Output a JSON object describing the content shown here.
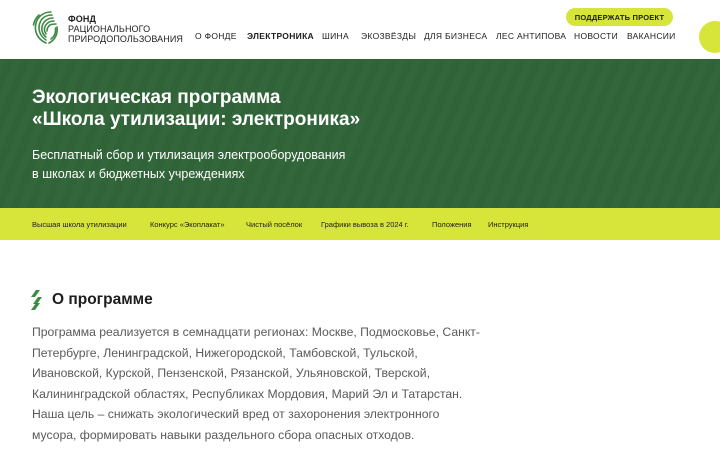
{
  "header": {
    "logo_lines": [
      "ФОНД",
      "РАЦИОНАЛЬНОГО",
      "ПРИРОДОПОЛЬЗОВАНИЯ"
    ],
    "support_button": "ПОДДЕРЖАТЬ ПРОЕКТ",
    "nav": [
      {
        "label": "О ФОНДЕ",
        "active": false
      },
      {
        "label": "ЭЛЕКТРОНИКА",
        "active": true
      },
      {
        "label": "ШИНА",
        "active": false
      },
      {
        "label": "ЭКОЗВЁЗДЫ",
        "active": false
      },
      {
        "label": "ДЛЯ БИЗНЕСА",
        "active": false
      },
      {
        "label": "ЛЕС АНТИПОВА",
        "active": false
      },
      {
        "label": "НОВОСТИ",
        "active": false
      },
      {
        "label": "ВАКАНСИИ",
        "active": false
      }
    ]
  },
  "hero": {
    "title_lines": [
      "Экологическая программа",
      "«Школа утилизации: электроника»"
    ],
    "subtitle_lines": [
      "Бесплатный сбор и утилизация электрооборудования",
      "в школах и бюджетных учреждениях"
    ]
  },
  "subnav": [
    "Высшая школа утилизации",
    "Конкурс «Экоплакат»",
    "Чистый посёлок",
    "Графики вывоза в 2024 г.",
    "Положения",
    "Инструкция"
  ],
  "about": {
    "title": "О программе",
    "lines": [
      "Программа реализуется в семнадцати регионах: Москве, Подмосковье, Санкт-",
      "Петербурге, Ленинградской, Нижегородской, Тамбовской, Тульской,",
      "Ивановской, Курской, Пензенской, Рязанской, Ульяновской, Тверской,",
      "Калининградской областях, Республиках Мордовия, Марий Эл и Татарстан.",
      "Наша цель – снижать экологический вред от захоронения электронного",
      "мусора, формировать навыки раздельного сбора опасных отходов."
    ]
  },
  "colors": {
    "accent": "#d7e53a",
    "hero_bg": "#33673b",
    "logo_green": "#3d8a43"
  },
  "icons": [
    "fingerprint-leaf-logo",
    "section-stripes-icon"
  ]
}
